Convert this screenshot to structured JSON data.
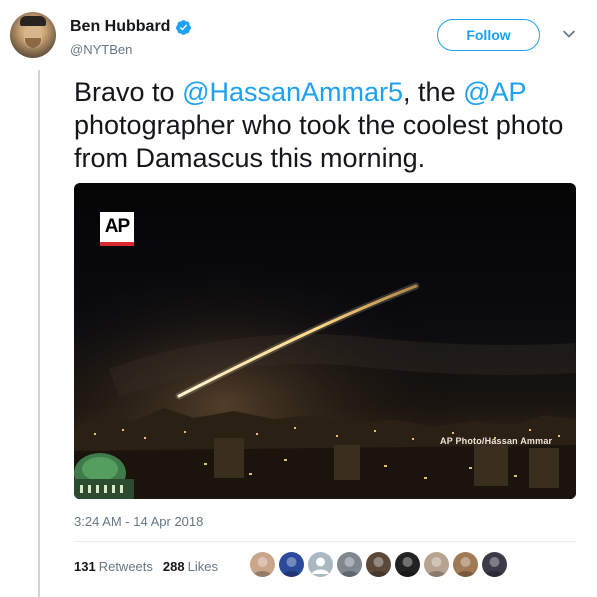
{
  "author": {
    "name": "Ben Hubbard",
    "handle": "@NYTBen",
    "verified": true
  },
  "follow_button": {
    "label": "Follow"
  },
  "tweet": {
    "text_parts": [
      {
        "text": "Bravo to ",
        "mention": false
      },
      {
        "text": "@HassanAmmar5",
        "mention": true
      },
      {
        "text": ", the ",
        "mention": false
      },
      {
        "text": "@AP",
        "mention": true
      },
      {
        "text": " photographer who took the coolest photo from Damascus this morning.",
        "mention": false
      }
    ]
  },
  "photo": {
    "logo": "AP",
    "credit": "AP Photo/Hassan Ammar"
  },
  "timestamp": "3:24 AM - 14 Apr 2018",
  "stats": {
    "retweets_count": "131",
    "retweets_label": "Retweets",
    "likes_count": "288",
    "likes_label": "Likes"
  },
  "likers": [
    {
      "icon": "avatar-woman-icon",
      "color": "#c9a58a"
    },
    {
      "icon": "avatar-superhero-icon",
      "color": "#2b4a9b"
    },
    {
      "icon": "default-avatar-icon",
      "color": "#aab8c2"
    },
    {
      "icon": "avatar-city-icon",
      "color": "#7e8790"
    },
    {
      "icon": "avatar-group-icon",
      "color": "#5b4a3c"
    },
    {
      "icon": "avatar-dark-icon",
      "color": "#222222"
    },
    {
      "icon": "avatar-man-icon",
      "color": "#b7a392"
    },
    {
      "icon": "avatar-beard-icon",
      "color": "#a07a55"
    },
    {
      "icon": "avatar-night-icon",
      "color": "#3a3a48"
    }
  ],
  "colors": {
    "accent": "#1da1f2",
    "text": "#14171a",
    "muted": "#657786",
    "ap_red": "#d8272e"
  }
}
